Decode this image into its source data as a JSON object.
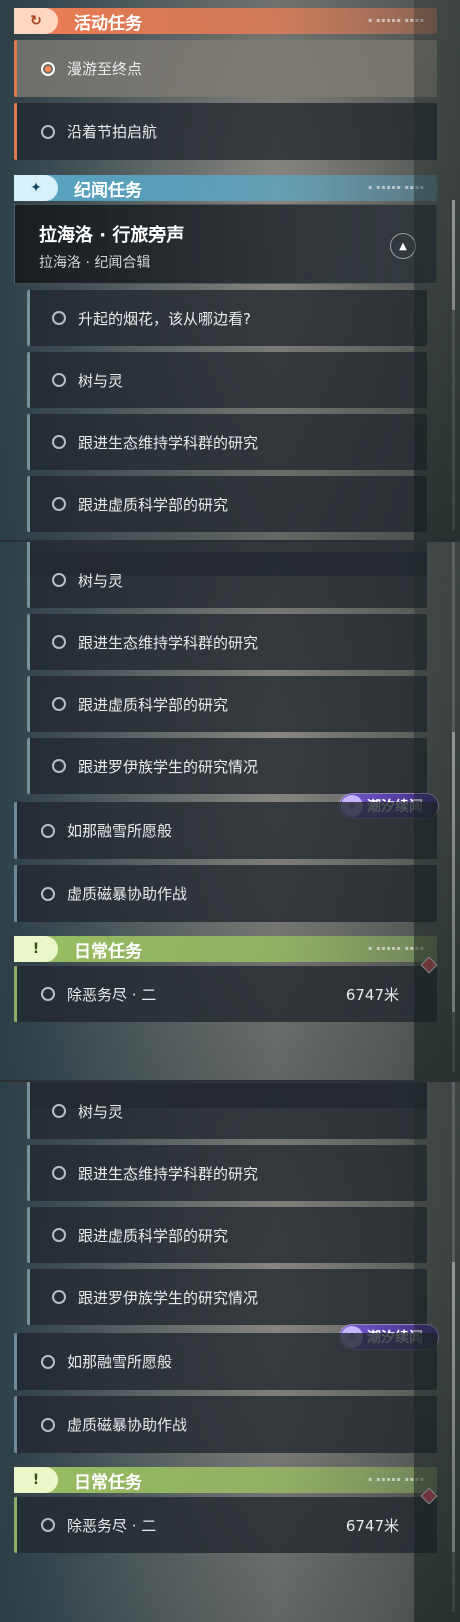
{
  "panel1": {
    "activity_header": {
      "title": "活动任务",
      "badge_icon": "↻"
    },
    "activity_items": [
      {
        "label": "漫游至终点",
        "active": true
      },
      {
        "label": "沿着节拍启航",
        "active": false
      }
    ],
    "chronicle_header": {
      "title": "纪闻任务",
      "badge_icon": "✦"
    },
    "chapter": {
      "title": "拉海洛 · 行旅旁声",
      "subtitle": "拉海洛 · 纪闻合辑",
      "collapse_icon": "▲"
    },
    "sub_items": [
      "升起的烟花，该从哪边看?",
      "树与灵",
      "跟进生态维持学科群的研究",
      "跟进虚质科学部的研究"
    ]
  },
  "panel2": {
    "sub_items": [
      "树与灵",
      "跟进生态维持学科群的研究",
      "跟进虚质科学部的研究",
      "跟进罗伊族学生的研究情况"
    ],
    "tag": {
      "label": "潮汐续闻"
    },
    "top_items": [
      "如那融雪所愿般",
      "虚质磁暴协助作战"
    ],
    "daily_header": {
      "title": "日常任务",
      "badge_icon": "!"
    },
    "daily_item": {
      "label": "除恶务尽 · 二",
      "distance": "6747米"
    }
  },
  "panel3": {
    "sub_items": [
      "树与灵",
      "跟进生态维持学科群的研究",
      "跟进虚质科学部的研究",
      "跟进罗伊族学生的研究情况"
    ],
    "tag": {
      "label": "潮汐续闻"
    },
    "top_items": [
      "如那融雪所愿般",
      "虚质磁暴协助作战"
    ],
    "daily_header": {
      "title": "日常任务",
      "badge_icon": "!"
    },
    "daily_item": {
      "label": "除恶务尽 · 二",
      "distance": "6747米"
    }
  },
  "colors": {
    "activity": "#f07e54",
    "chronicle": "#5aa7c6",
    "daily": "#9bc062",
    "tidal_tag": "#7a5bd6"
  }
}
